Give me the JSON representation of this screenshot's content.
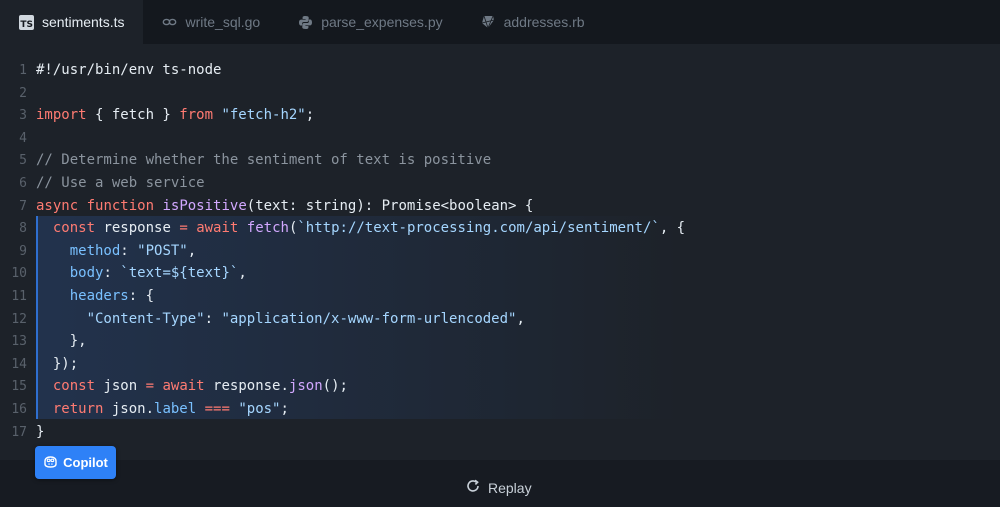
{
  "tabs": [
    {
      "label": "sentiments.ts",
      "icon": "typescript-icon",
      "badge": "TS",
      "active": true
    },
    {
      "label": "write_sql.go",
      "icon": "go-icon",
      "active": false
    },
    {
      "label": "parse_expenses.py",
      "icon": "python-icon",
      "active": false
    },
    {
      "label": "addresses.rb",
      "icon": "ruby-icon",
      "active": false
    }
  ],
  "editor": {
    "lines": [
      {
        "num": "1",
        "tokens": [
          {
            "t": "#!/usr/bin/env ts-node",
            "c": "txt"
          }
        ]
      },
      {
        "num": "2",
        "tokens": []
      },
      {
        "num": "3",
        "tokens": [
          {
            "t": "import",
            "c": "kw"
          },
          {
            "t": " { fetch } ",
            "c": "txt"
          },
          {
            "t": "from",
            "c": "kw"
          },
          {
            "t": " ",
            "c": "txt"
          },
          {
            "t": "\"fetch-h2\"",
            "c": "str"
          },
          {
            "t": ";",
            "c": "txt"
          }
        ]
      },
      {
        "num": "4",
        "tokens": []
      },
      {
        "num": "5",
        "tokens": [
          {
            "t": "// Determine whether the sentiment of text is positive",
            "c": "cm"
          }
        ]
      },
      {
        "num": "6",
        "tokens": [
          {
            "t": "// Use a web service",
            "c": "cm"
          }
        ]
      },
      {
        "num": "7",
        "tokens": [
          {
            "t": "async",
            "c": "kw"
          },
          {
            "t": " ",
            "c": "txt"
          },
          {
            "t": "function",
            "c": "kw"
          },
          {
            "t": " ",
            "c": "txt"
          },
          {
            "t": "isPositive",
            "c": "fn"
          },
          {
            "t": "(text: string): Promise<boolean> {",
            "c": "txt"
          }
        ]
      },
      {
        "num": "8",
        "tokens": [
          {
            "t": "  ",
            "c": "txt"
          },
          {
            "t": "const",
            "c": "kw"
          },
          {
            "t": " response ",
            "c": "txt"
          },
          {
            "t": "=",
            "c": "kw"
          },
          {
            "t": " ",
            "c": "txt"
          },
          {
            "t": "await",
            "c": "kw"
          },
          {
            "t": " ",
            "c": "txt"
          },
          {
            "t": "fetch",
            "c": "fn"
          },
          {
            "t": "(",
            "c": "txt"
          },
          {
            "t": "`http://text-processing.com/api/sentiment/`",
            "c": "str"
          },
          {
            "t": ", {",
            "c": "txt"
          }
        ]
      },
      {
        "num": "9",
        "tokens": [
          {
            "t": "    ",
            "c": "txt"
          },
          {
            "t": "method",
            "c": "prop"
          },
          {
            "t": ": ",
            "c": "txt"
          },
          {
            "t": "\"POST\"",
            "c": "str"
          },
          {
            "t": ",",
            "c": "txt"
          }
        ]
      },
      {
        "num": "10",
        "tokens": [
          {
            "t": "    ",
            "c": "txt"
          },
          {
            "t": "body",
            "c": "prop"
          },
          {
            "t": ": ",
            "c": "txt"
          },
          {
            "t": "`text=${text}`",
            "c": "str"
          },
          {
            "t": ",",
            "c": "txt"
          }
        ]
      },
      {
        "num": "11",
        "tokens": [
          {
            "t": "    ",
            "c": "txt"
          },
          {
            "t": "headers",
            "c": "prop"
          },
          {
            "t": ": {",
            "c": "txt"
          }
        ]
      },
      {
        "num": "12",
        "tokens": [
          {
            "t": "      ",
            "c": "txt"
          },
          {
            "t": "\"Content-Type\"",
            "c": "str"
          },
          {
            "t": ": ",
            "c": "txt"
          },
          {
            "t": "\"application/x-www-form-urlencoded\"",
            "c": "str"
          },
          {
            "t": ",",
            "c": "txt"
          }
        ]
      },
      {
        "num": "13",
        "tokens": [
          {
            "t": "    },",
            "c": "txt"
          }
        ]
      },
      {
        "num": "14",
        "tokens": [
          {
            "t": "  });",
            "c": "txt"
          }
        ]
      },
      {
        "num": "15",
        "tokens": [
          {
            "t": "  ",
            "c": "txt"
          },
          {
            "t": "const",
            "c": "kw"
          },
          {
            "t": " json ",
            "c": "txt"
          },
          {
            "t": "=",
            "c": "kw"
          },
          {
            "t": " ",
            "c": "txt"
          },
          {
            "t": "await",
            "c": "kw"
          },
          {
            "t": " response.",
            "c": "txt"
          },
          {
            "t": "json",
            "c": "fn"
          },
          {
            "t": "();",
            "c": "txt"
          }
        ]
      },
      {
        "num": "16",
        "tokens": [
          {
            "t": "  ",
            "c": "txt"
          },
          {
            "t": "return",
            "c": "kw"
          },
          {
            "t": " json.",
            "c": "txt"
          },
          {
            "t": "label",
            "c": "prop"
          },
          {
            "t": " ",
            "c": "txt"
          },
          {
            "t": "===",
            "c": "kw"
          },
          {
            "t": " ",
            "c": "txt"
          },
          {
            "t": "\"pos\"",
            "c": "str"
          },
          {
            "t": ";",
            "c": "txt"
          }
        ]
      },
      {
        "num": "17",
        "tokens": [
          {
            "t": "}",
            "c": "txt"
          }
        ]
      }
    ]
  },
  "copilot_button": {
    "label": "Copilot",
    "icon": "copilot-icon"
  },
  "replay_button": {
    "label": "Replay",
    "icon": "replay-icon"
  },
  "colors": {
    "accent": "#2e81f7",
    "keyword": "#ff7b72",
    "string": "#a5d6ff",
    "comment": "#8b949e"
  }
}
